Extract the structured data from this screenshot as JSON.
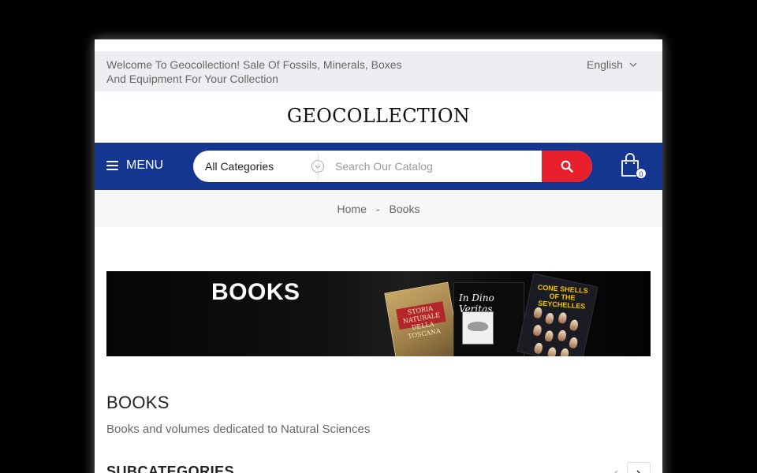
{
  "topbar": {
    "welcome": "Welcome To Geocollection! Sale Of Fossils, Minerals, Boxes And Equipment For Your Collection",
    "language": "English"
  },
  "logo": {
    "text": "GEOCOLLECTION"
  },
  "navbar": {
    "menu_label": "MENU",
    "category_selected": "All Categories",
    "search_placeholder": "Search Our Catalog",
    "cart_count": "0",
    "accent_color": "#143590",
    "search_button_color": "#e8202d"
  },
  "breadcrumb": {
    "items": [
      "Home",
      "Books"
    ],
    "separator": "-"
  },
  "banner": {
    "title": "BOOKS",
    "book1_title": "STORIA NATURALE DELLA TOSCANA",
    "book2_title": "In Dino Veritas",
    "book3_title": "CONE SHELLS OF THE SEYCHELLES"
  },
  "category": {
    "title": "BOOKS",
    "description": "Books and volumes dedicated to Natural Sciences",
    "subcategories_heading": "SUBCATEGORIES"
  },
  "icons": {
    "menu": "hamburger-icon",
    "select": "chevron-down-icon",
    "search": "search-icon",
    "cart": "shopping-bag-icon",
    "prev": "chevron-left-icon",
    "next": "chevron-right-icon"
  }
}
